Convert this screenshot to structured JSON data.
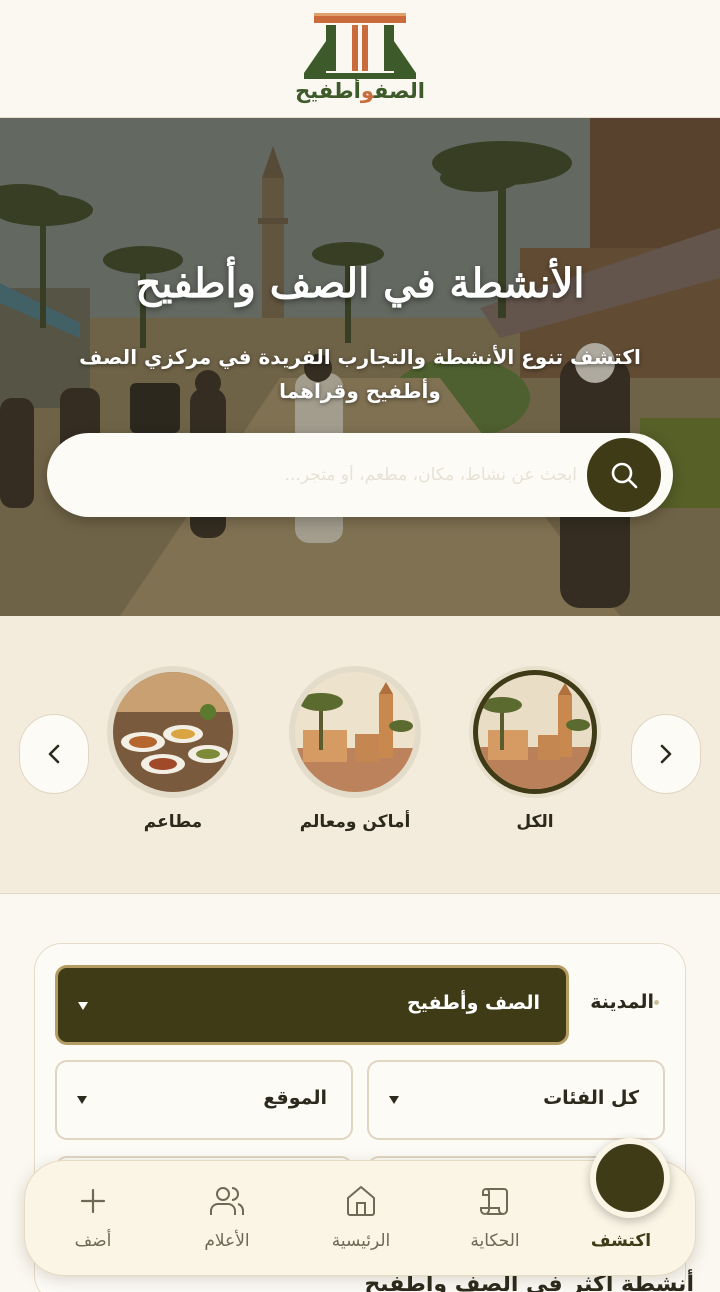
{
  "header": {
    "logo_text_main": "الصف",
    "logo_text_connector": "و",
    "logo_text_end": "أطفيح"
  },
  "hero": {
    "title": "الأنشطة في الصف وأطفيح",
    "subtitle": "اكتشف تنوع الأنشطة والتجارب الفريدة في مركزي الصف وأطفيح وقراهما",
    "search_placeholder": "ابحث عن نشاط، مكان، مطعم، أو متجر..."
  },
  "categories": [
    {
      "label": "الكل",
      "icon": "town-photo"
    },
    {
      "label": "أماكن ومعالم",
      "icon": "town-photo"
    },
    {
      "label": "مطاعم",
      "icon": "food-photo"
    }
  ],
  "filters": {
    "city_label": "المدينة",
    "city_value": "الصف وأطفيح",
    "category_value": "كل الفئات",
    "location_value": "الموقع"
  },
  "peek_text": "أنشطة أكثر في الصف وأطفيح",
  "bottom_nav": [
    {
      "label": "اكتشف",
      "icon": "explore-icon"
    },
    {
      "label": "الحكاية",
      "icon": "scroll-icon"
    },
    {
      "label": "الرئيسية",
      "icon": "home-icon"
    },
    {
      "label": "الأعلام",
      "icon": "people-icon"
    },
    {
      "label": "أضف",
      "icon": "plus-icon"
    }
  ],
  "colors": {
    "primary": "#3f3b17",
    "accent_gold": "#b59c62",
    "background": "#fbf8f1",
    "section_bg": "#f3ebdc"
  }
}
